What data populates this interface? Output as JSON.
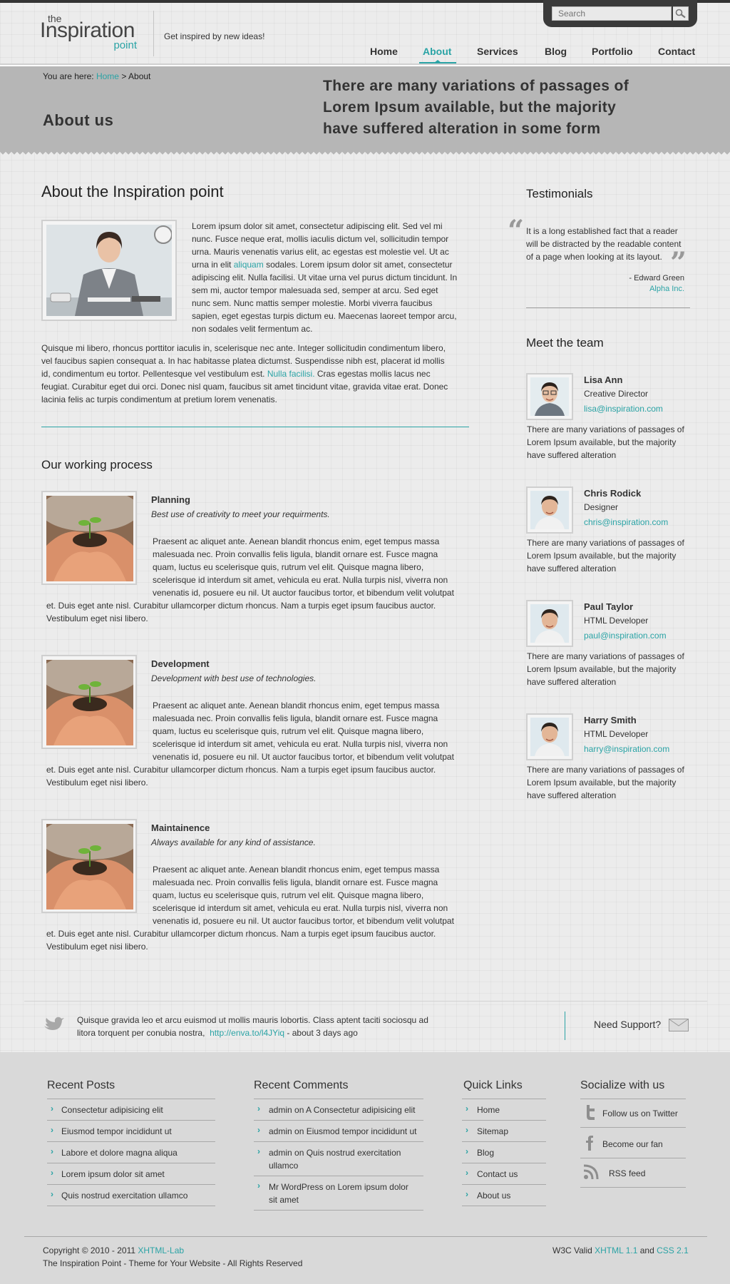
{
  "header": {
    "logo": {
      "the": "the",
      "main": "Inspiration",
      "point": "point"
    },
    "tagline": "Get inspired by new ideas!",
    "search_placeholder": "Search",
    "nav": [
      "Home",
      "About",
      "Services",
      "Blog",
      "Portfolio",
      "Contact"
    ],
    "nav_active": "About",
    "accent": "#2aa3a5"
  },
  "banner": {
    "crumb_prefix": "You are here:",
    "crumb_home": "Home",
    "crumb_sep": ">",
    "crumb_current": "About",
    "title": "About us",
    "quote_lines": [
      "There are many variations of passages of",
      "Lorem Ipsum available, but the majority",
      "have suffered alteration in some form"
    ]
  },
  "about": {
    "heading": "About the Inspiration point",
    "p1_lines": [
      "Lorem ipsum dolor sit amet, consectetur adipiscing elit. Sed vel mi",
      "nunc. Fusce neque erat, mollis iaculis dictum vel, sollicitudin tempor",
      "urna. Mauris venenatis varius elit, ac egestas est molestie vel. Ut ac"
    ],
    "p1_l4_a": "urna in elit ",
    "p1_l4_link": "aliquam",
    "p1_l4_b": " sodales. Lorem ipsum dolor sit amet, consectetur",
    "p1_rest": [
      "adipiscing elit. Nulla facilisi. Ut vitae urna vel purus dictum tincidunt. In",
      "sem mi, auctor tempor malesuada sed, semper at arcu. Sed eget",
      "nunc sem. Nunc mattis semper molestie. Morbi viverra faucibus",
      "sapien, eget egestas turpis dictum eu. Maecenas laoreet tempor arcu,",
      "non sodales velit fermentum ac."
    ],
    "p2_lines": [
      "Quisque mi libero, rhoncus porttitor iaculis in, scelerisque nec ante. Integer sollicitudin condimentum libero,",
      "vel faucibus sapien consequat a. In hac habitasse platea dictumst. Suspendisse nibh est, placerat id mollis"
    ],
    "p2_l3_a": "id, condimentum eu tortor. Pellentesque vel vestibulum est. ",
    "p2_l3_link": "Nulla facilisi.",
    "p2_l3_b": " Cras egestas mollis lacus nec",
    "p2_rest": [
      "feugiat. Curabitur eget dui orci. Donec nisl quam, faucibus sit amet tincidunt vitae, gravida vitae erat. Donec",
      "lacinia felis ac turpis condimentum at pretium lorem venenatis."
    ]
  },
  "process": {
    "heading": "Our working process",
    "body_lines": [
      "Praesent ac aliquet ante. Aenean blandit rhoncus enim, eget tempus massa",
      "malesuada nec. Proin convallis felis ligula, blandit ornare est. Fusce magna",
      "quam, luctus eu scelerisque quis, rutrum vel elit. Quisque magna libero,",
      "scelerisque id interdum sit amet, vehicula eu erat. Nulla turpis nisl, viverra non",
      "venenatis id, posuere eu nil. Ut auctor faucibus tortor, et bibendum velit volutpat"
    ],
    "body_wide_lines": [
      "et. Duis eget ante nisl. Curabitur ullamcorper dictum rhoncus. Nam a turpis eget ipsum faucibus auctor.",
      "Vestibulum eget nisi libero."
    ],
    "items": [
      {
        "title": "Planning",
        "subtitle": "Best use of creativity to meet your requirments."
      },
      {
        "title": "Development",
        "subtitle": "Development with best use of technologies."
      },
      {
        "title": "Maintainence",
        "subtitle": "Always available for any kind of assistance."
      }
    ]
  },
  "testimonials": {
    "heading": "Testimonials",
    "text_lines": [
      "It is a long established fact that a reader",
      "will be distracted by the readable content",
      "of a page when looking at its layout."
    ],
    "author": "- Edward Green",
    "company": "Alpha Inc."
  },
  "team": {
    "heading": "Meet the team",
    "bio_lines": [
      "There are many variations of passages of",
      "Lorem Ipsum available, but the majority",
      "have suffered alteration"
    ],
    "members": [
      {
        "name": "Lisa Ann",
        "role": "Creative Director",
        "email": "lisa@inspiration.com"
      },
      {
        "name": "Chris Rodick",
        "role": "Designer",
        "email": "chris@inspiration.com"
      },
      {
        "name": "Paul Taylor",
        "role": "HTML Developer",
        "email": "paul@inspiration.com"
      },
      {
        "name": "Harry Smith",
        "role": "HTML Developer",
        "email": "harry@inspiration.com"
      }
    ]
  },
  "twitter": {
    "line1": "Quisque gravida leo et arcu euismod ut mollis mauris lobortis. Class aptent taciti sociosqu ad",
    "line2_a": "litora torquent per conubia nostra,",
    "link": "http://enva.to/l4JYiq",
    "line2_b": "- about 3 days ago",
    "support": "Need Support?"
  },
  "footer": {
    "recent_posts": {
      "title": "Recent Posts",
      "items": [
        "Consectetur adipisicing  elit",
        "Eiusmod tempor incididunt ut",
        "Labore et dolore magna aliqua",
        "Lorem ipsum dolor sit amet",
        "Quis nostrud exercitation ullamco"
      ]
    },
    "recent_comments": {
      "title": "Recent Comments",
      "items": [
        {
          "l1": "admin on A Consectetur adipisicing  elit",
          "l2": ""
        },
        {
          "l1": "admin on Eiusmod tempor incididunt ut",
          "l2": ""
        },
        {
          "l1": "admin on Quis nostrud exercitation",
          "l2": "ullamco"
        },
        {
          "l1": "Mr WordPress on Lorem ipsum dolor",
          "l2": "sit amet"
        }
      ]
    },
    "quick_links": {
      "title": "Quick Links",
      "items": [
        "Home",
        "Sitemap",
        "Blog",
        "Contact us",
        "About us"
      ]
    },
    "social": {
      "title": "Socialize with us",
      "items": [
        "Follow us on Twitter",
        "Become our fan",
        "RSS feed"
      ]
    },
    "copyright_a": "Copyright © 2010 - 2011",
    "copyright_link": "XHTML-Lab",
    "copyright_line2": "The Inspiration Point - Theme for Your Website - All Rights Reserved",
    "valid_a": "W3C Valid",
    "valid_xhtml": "XHTML 1.1",
    "valid_and": "and",
    "valid_css": "CSS 2.1"
  }
}
